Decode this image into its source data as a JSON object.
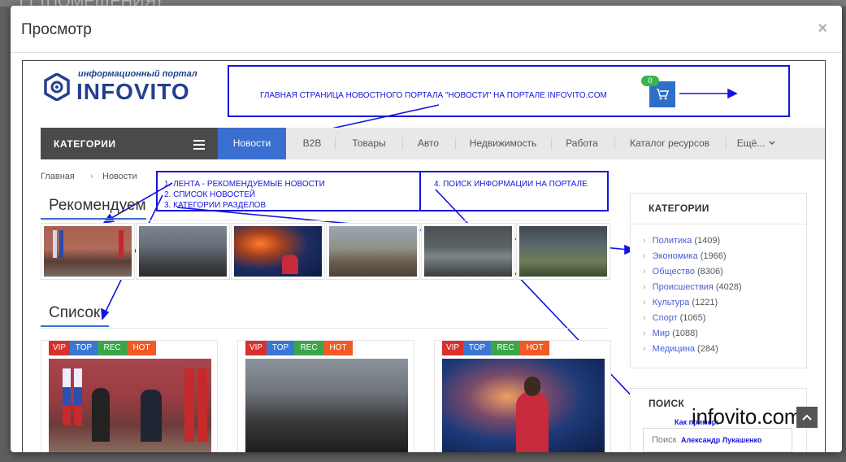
{
  "background": {
    "text": "ТТ (ПОМЕЩЕНИЯ)"
  },
  "modal": {
    "title": "Просмотр",
    "close_symbol": "×"
  },
  "site": {
    "logo_tagline": "информационный портал",
    "logo_name": "INFOVITO",
    "cart_count": "0"
  },
  "annotations": {
    "main_page": "ГЛАВНАЯ СТРАНИЦА  НОВОСТНОГО ПОРТАЛА \"НОВОСТИ\" НА ПОРТАЛЕ INFOVITO.COM",
    "list_lines": [
      "1.  ЛЕНТА - РЕКОМЕНДУЕМЫЕ НОВОСТИ",
      "2.  СПИСОК НОВОСТЕЙ",
      "3.  КАТЕГОРИИ РАЗДЕЛОВ"
    ],
    "search": "4. ПОИСК ИНФОРМАЦИИ  НА ПОРТАЛЕ"
  },
  "nav": {
    "categories_label": "КАТЕГОРИИ",
    "items": [
      "Новости",
      "B2B",
      "Товары",
      "Авто",
      "Недвижимость",
      "Работа",
      "Каталог ресурсов",
      "Ещё..."
    ]
  },
  "breadcrumb": {
    "home": "Главная",
    "sep": "›",
    "current": "Новости"
  },
  "sections": {
    "recommended": "Рекомендуем",
    "list": "Список"
  },
  "tags": [
    "VIP",
    "TOP",
    "REC",
    "HOT"
  ],
  "sidebar": {
    "title": "КАТЕГОРИИ",
    "chevron": "›",
    "categories": [
      {
        "name": "Политика",
        "count": "(1409)"
      },
      {
        "name": "Экономика",
        "count": "(1966)"
      },
      {
        "name": "Общество",
        "count": "(8306)"
      },
      {
        "name": "Происшествия",
        "count": "(4028)"
      },
      {
        "name": "Культура",
        "count": "(1221)"
      },
      {
        "name": "Спорт",
        "count": "(1065)"
      },
      {
        "name": "Мир",
        "count": "(1088)"
      },
      {
        "name": "Медицина",
        "count": "(284)"
      }
    ],
    "search_title": "ПОИСК",
    "search_hint": "Как пример:",
    "search_placeholder": "Поиск",
    "search_example": "Александр Лукашенко"
  },
  "watermark": "infovito.com",
  "colors": {
    "accent": "#3a6fd0",
    "annotation": "#1414e0",
    "vip": "#d9302c",
    "top": "#3b76d3",
    "rec": "#3aa64a",
    "hot": "#f15a24"
  }
}
